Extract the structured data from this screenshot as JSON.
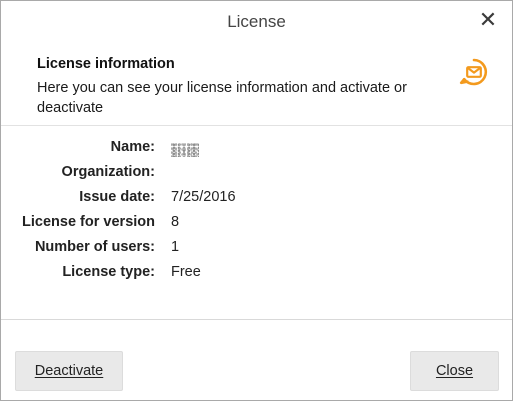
{
  "window": {
    "title": "License",
    "close_glyph": "✕"
  },
  "header": {
    "title": "License information",
    "description": "Here you can see your license information and activate or deactivate",
    "icon": "envelope-clock-icon",
    "icon_color": "#f39a1e"
  },
  "fields": [
    {
      "label": "Name:",
      "value": ""
    },
    {
      "label": "Organization:",
      "value": ""
    },
    {
      "label": "Issue date:",
      "value": "7/25/2016"
    },
    {
      "label": "License for version",
      "value": "8"
    },
    {
      "label": "Number of users:",
      "value": "1"
    },
    {
      "label": "License type:",
      "value": "Free"
    }
  ],
  "buttons": {
    "deactivate": "Deactivate",
    "close": "Close"
  }
}
